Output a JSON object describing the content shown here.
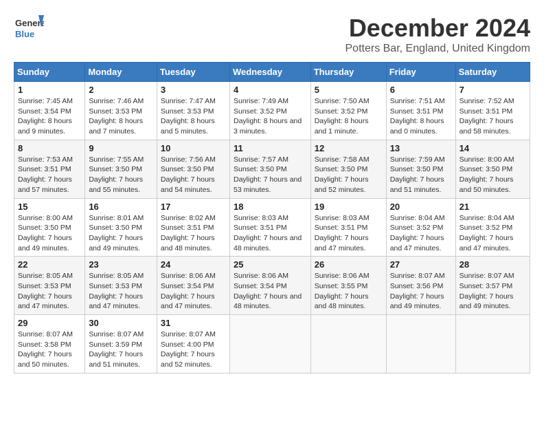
{
  "header": {
    "logo_general": "General",
    "logo_blue": "Blue",
    "title": "December 2024",
    "subtitle": "Potters Bar, England, United Kingdom"
  },
  "weekdays": [
    "Sunday",
    "Monday",
    "Tuesday",
    "Wednesday",
    "Thursday",
    "Friday",
    "Saturday"
  ],
  "weeks": [
    [
      {
        "day": "1",
        "sunrise": "7:45 AM",
        "sunset": "3:54 PM",
        "daylight": "8 hours and 9 minutes."
      },
      {
        "day": "2",
        "sunrise": "7:46 AM",
        "sunset": "3:53 PM",
        "daylight": "8 hours and 7 minutes."
      },
      {
        "day": "3",
        "sunrise": "7:47 AM",
        "sunset": "3:53 PM",
        "daylight": "8 hours and 5 minutes."
      },
      {
        "day": "4",
        "sunrise": "7:49 AM",
        "sunset": "3:52 PM",
        "daylight": "8 hours and 3 minutes."
      },
      {
        "day": "5",
        "sunrise": "7:50 AM",
        "sunset": "3:52 PM",
        "daylight": "8 hours and 1 minute."
      },
      {
        "day": "6",
        "sunrise": "7:51 AM",
        "sunset": "3:51 PM",
        "daylight": "8 hours and 0 minutes."
      },
      {
        "day": "7",
        "sunrise": "7:52 AM",
        "sunset": "3:51 PM",
        "daylight": "7 hours and 58 minutes."
      }
    ],
    [
      {
        "day": "8",
        "sunrise": "7:53 AM",
        "sunset": "3:51 PM",
        "daylight": "7 hours and 57 minutes."
      },
      {
        "day": "9",
        "sunrise": "7:55 AM",
        "sunset": "3:50 PM",
        "daylight": "7 hours and 55 minutes."
      },
      {
        "day": "10",
        "sunrise": "7:56 AM",
        "sunset": "3:50 PM",
        "daylight": "7 hours and 54 minutes."
      },
      {
        "day": "11",
        "sunrise": "7:57 AM",
        "sunset": "3:50 PM",
        "daylight": "7 hours and 53 minutes."
      },
      {
        "day": "12",
        "sunrise": "7:58 AM",
        "sunset": "3:50 PM",
        "daylight": "7 hours and 52 minutes."
      },
      {
        "day": "13",
        "sunrise": "7:59 AM",
        "sunset": "3:50 PM",
        "daylight": "7 hours and 51 minutes."
      },
      {
        "day": "14",
        "sunrise": "8:00 AM",
        "sunset": "3:50 PM",
        "daylight": "7 hours and 50 minutes."
      }
    ],
    [
      {
        "day": "15",
        "sunrise": "8:00 AM",
        "sunset": "3:50 PM",
        "daylight": "7 hours and 49 minutes."
      },
      {
        "day": "16",
        "sunrise": "8:01 AM",
        "sunset": "3:50 PM",
        "daylight": "7 hours and 49 minutes."
      },
      {
        "day": "17",
        "sunrise": "8:02 AM",
        "sunset": "3:51 PM",
        "daylight": "7 hours and 48 minutes."
      },
      {
        "day": "18",
        "sunrise": "8:03 AM",
        "sunset": "3:51 PM",
        "daylight": "7 hours and 48 minutes."
      },
      {
        "day": "19",
        "sunrise": "8:03 AM",
        "sunset": "3:51 PM",
        "daylight": "7 hours and 47 minutes."
      },
      {
        "day": "20",
        "sunrise": "8:04 AM",
        "sunset": "3:52 PM",
        "daylight": "7 hours and 47 minutes."
      },
      {
        "day": "21",
        "sunrise": "8:04 AM",
        "sunset": "3:52 PM",
        "daylight": "7 hours and 47 minutes."
      }
    ],
    [
      {
        "day": "22",
        "sunrise": "8:05 AM",
        "sunset": "3:53 PM",
        "daylight": "7 hours and 47 minutes."
      },
      {
        "day": "23",
        "sunrise": "8:05 AM",
        "sunset": "3:53 PM",
        "daylight": "7 hours and 47 minutes."
      },
      {
        "day": "24",
        "sunrise": "8:06 AM",
        "sunset": "3:54 PM",
        "daylight": "7 hours and 47 minutes."
      },
      {
        "day": "25",
        "sunrise": "8:06 AM",
        "sunset": "3:54 PM",
        "daylight": "7 hours and 48 minutes."
      },
      {
        "day": "26",
        "sunrise": "8:06 AM",
        "sunset": "3:55 PM",
        "daylight": "7 hours and 48 minutes."
      },
      {
        "day": "27",
        "sunrise": "8:07 AM",
        "sunset": "3:56 PM",
        "daylight": "7 hours and 49 minutes."
      },
      {
        "day": "28",
        "sunrise": "8:07 AM",
        "sunset": "3:57 PM",
        "daylight": "7 hours and 49 minutes."
      }
    ],
    [
      {
        "day": "29",
        "sunrise": "8:07 AM",
        "sunset": "3:58 PM",
        "daylight": "7 hours and 50 minutes."
      },
      {
        "day": "30",
        "sunrise": "8:07 AM",
        "sunset": "3:59 PM",
        "daylight": "7 hours and 51 minutes."
      },
      {
        "day": "31",
        "sunrise": "8:07 AM",
        "sunset": "4:00 PM",
        "daylight": "7 hours and 52 minutes."
      },
      null,
      null,
      null,
      null
    ]
  ]
}
